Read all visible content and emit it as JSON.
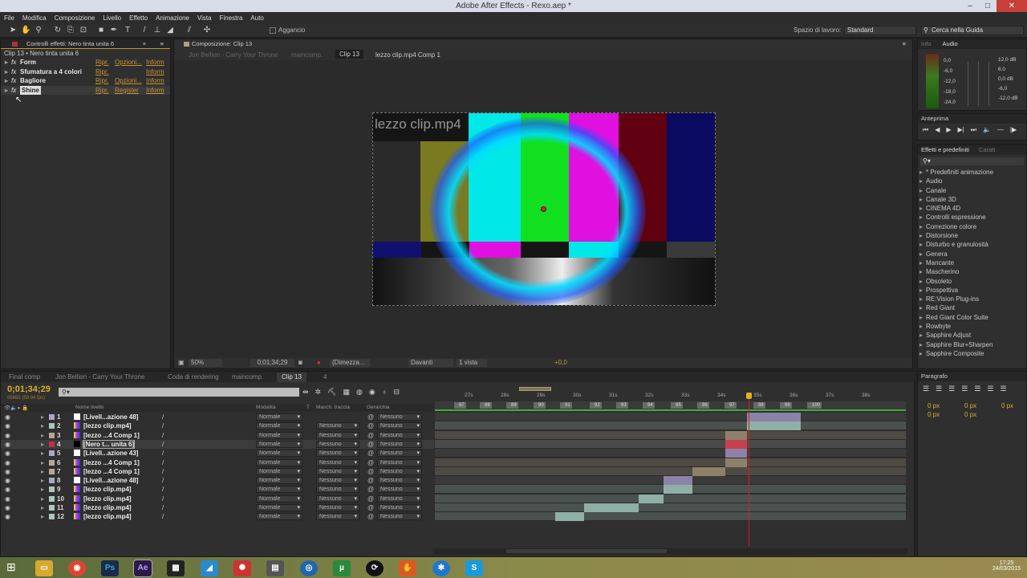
{
  "window": {
    "title": "Adobe After Effects - Rexo.aep *",
    "minimize": "–",
    "maximize": "□",
    "close": "✕"
  },
  "menu": [
    "File",
    "Modifica",
    "Composizione",
    "Livello",
    "Effetto",
    "Animazione",
    "Vista",
    "Finestra",
    "Auto"
  ],
  "toolbar": {
    "snap_label": "Aggancio",
    "workspace_label": "Spazio di lavoro:",
    "workspace_value": "Standard",
    "help_search": "Cerca nella Guida"
  },
  "effect_controls": {
    "tab": "Controlli effetti: Nero tinta unita 6",
    "breadcrumb": "Clip 13 • Nero tinta unita 6",
    "effects": [
      {
        "name": "Form",
        "links": [
          "Ripr.",
          "Opzioni...",
          "Inform"
        ]
      },
      {
        "name": "Sfumatura a 4 colori",
        "links": [
          "Ripr.",
          "",
          "Inform"
        ]
      },
      {
        "name": "Bagliore",
        "links": [
          "Ripr.",
          "Opzioni...",
          "Inform"
        ]
      },
      {
        "name": "Shine",
        "links": [
          "Ripr.",
          "Register",
          "Inform"
        ]
      }
    ]
  },
  "composition": {
    "tab": "Composizione: Clip 13",
    "nav": [
      "Jon Bellion - Carry Your Throne",
      "maincomp.",
      "Clip 13",
      "lezzo clip.mp4 Comp 1"
    ],
    "overlay_text": "lezzo clip.mp4",
    "footer": {
      "zoom": "50%",
      "timecode": "0;01;34;29",
      "resolution": "(Dimezza...",
      "view": "Davanti",
      "views": "1 vista",
      "exposure": "+0,0"
    }
  },
  "info_panel": {
    "tabs": [
      "Info",
      "Audio"
    ],
    "levels": [
      "0,0",
      "-6,0",
      "-12,0",
      "-18,0",
      "-24,0"
    ],
    "db": [
      "12,0 dB",
      "6,0",
      "0,0 dB",
      "-6,0",
      "-12,0 dB"
    ]
  },
  "preview_panel": {
    "tab": "Anteprima"
  },
  "effects_presets": {
    "tabs": [
      "Effetti e predefiniti",
      "Caratt"
    ],
    "items": [
      "* Predefiniti animazione",
      "Audio",
      "Canale",
      "Canale 3D",
      "CINEMA 4D",
      "Controlli espressione",
      "Correzione colore",
      "Distorsione",
      "Disturbo e granulosità",
      "Genera",
      "Mancante",
      "Mascherino",
      "Obsoleto",
      "Prospettiva",
      "RE:Vision Plug-ins",
      "Red Giant",
      "Red Giant Color Suite",
      "Rowbyte",
      "Sapphire Adjust",
      "Sapphire Blur+Sharpen",
      "Sapphire Composite"
    ]
  },
  "paragraph_panel": {
    "tab": "Paragrafo",
    "fields": [
      "0 px",
      "0 px",
      "0 px",
      "0 px",
      "0 px"
    ]
  },
  "timeline": {
    "tabs": [
      "Final comp",
      "Jon Bellion - Carry Your Throne",
      "Coda di rendering",
      "maincomp.",
      "Clip 13",
      "4"
    ],
    "timecode": "0;01;34;29",
    "frame_info": "05665 (59,94 fps)",
    "columns": {
      "name": "Nome livello",
      "mode": "Modalità",
      "t": "T",
      "matte": "Masch. traccia",
      "parent": "Gerarchia"
    },
    "ruler": [
      "27s",
      "28s",
      "29s",
      "30s",
      "31s",
      "32s",
      "33s",
      "34s",
      "35s",
      "36s",
      "37s",
      "38s"
    ],
    "markers": [
      "87",
      "88",
      "89",
      "90",
      "91",
      "92",
      "93",
      "94",
      "95",
      "96",
      "97",
      "98",
      "99",
      "100"
    ],
    "playhead_s": 34.75,
    "layers": [
      {
        "num": "1",
        "name": "[Livell...azione 48]",
        "color": "#a8a8c8",
        "mode": "Normale",
        "matte": "",
        "parent": "Nessuno",
        "in": 34.7,
        "out": 36.2,
        "bar": "#8a82a8",
        "bg": "#3a3a3a"
      },
      {
        "num": "2",
        "name": "[lezzo clip.mp4]",
        "color": "#a8c8c0",
        "mode": "Normale",
        "matte": "Nessuno",
        "parent": "Nessuno",
        "in": 34.7,
        "out": 36.2,
        "bar": "#8fb0a6",
        "bg": "#4a524f"
      },
      {
        "num": "3",
        "name": "[lezzo ...4 Comp 1]",
        "color": "#b8a890",
        "mode": "Normale",
        "matte": "Nessuno",
        "parent": "Nessuno",
        "in": 34.1,
        "out": 34.7,
        "bar": "#8f8068",
        "bg": "#4e4a44"
      },
      {
        "num": "4",
        "name": "[Nero t... unita 6]",
        "color": "#c03040",
        "mode": "Normale",
        "matte": "Nessuno",
        "parent": "Nessuno",
        "in": 34.1,
        "out": 34.7,
        "bar": "#c84050",
        "bg": "#4a4a4a"
      },
      {
        "num": "5",
        "name": "[Livell...azione 43]",
        "color": "#a8a8c8",
        "mode": "Normale",
        "matte": "Nessuno",
        "parent": "Nessuno",
        "in": 34.1,
        "out": 34.7,
        "bar": "#8a82a8",
        "bg": "#3a3a3a"
      },
      {
        "num": "6",
        "name": "[lezzo ...4 Comp 1]",
        "color": "#b8a890",
        "mode": "Normale",
        "matte": "Nessuno",
        "parent": "Nessuno",
        "in": 34.1,
        "out": 34.7,
        "bar": "#8f8068",
        "bg": "#4e4a44"
      },
      {
        "num": "7",
        "name": "[lezzo ...4 Comp 1]",
        "color": "#b8a890",
        "mode": "Normale",
        "matte": "Nessuno",
        "parent": "Nessuno",
        "in": 33.2,
        "out": 34.1,
        "bar": "#8f8068",
        "bg": "#4e4a44"
      },
      {
        "num": "8",
        "name": "[Livell...azione 48]",
        "color": "#a8a8c8",
        "mode": "Normale",
        "matte": "Nessuno",
        "parent": "Nessuno",
        "in": 32.4,
        "out": 33.2,
        "bar": "#8a82a8",
        "bg": "#3a3a3a"
      },
      {
        "num": "9",
        "name": "[lezzo clip.mp4]",
        "color": "#a8c8c0",
        "mode": "Normale",
        "matte": "Nessuno",
        "parent": "Nessuno",
        "in": 32.4,
        "out": 33.2,
        "bar": "#8fb0a6",
        "bg": "#4a524f"
      },
      {
        "num": "10",
        "name": "[lezzo clip.mp4]",
        "color": "#a8c8c0",
        "mode": "Normale",
        "matte": "Nessuno",
        "parent": "Nessuno",
        "in": 31.7,
        "out": 32.4,
        "bar": "#8fb0a6",
        "bg": "#4a524f"
      },
      {
        "num": "11",
        "name": "[lezzo clip.mp4]",
        "color": "#a8c8c0",
        "mode": "Normale",
        "matte": "Nessuno",
        "parent": "Nessuno",
        "in": 30.2,
        "out": 31.7,
        "bar": "#8fb0a6",
        "bg": "#4a524f"
      },
      {
        "num": "12",
        "name": "[lezzo clip.mp4]",
        "color": "#a8c8c0",
        "mode": "Normale",
        "matte": "Nessuno",
        "parent": "Nessuno",
        "in": 29.4,
        "out": 30.2,
        "bar": "#8fb0a6",
        "bg": "#4a524f"
      }
    ]
  },
  "taskbar": {
    "time": "17:25",
    "date": "24/03/2015",
    "apps": [
      "Ps",
      "Ae"
    ]
  }
}
